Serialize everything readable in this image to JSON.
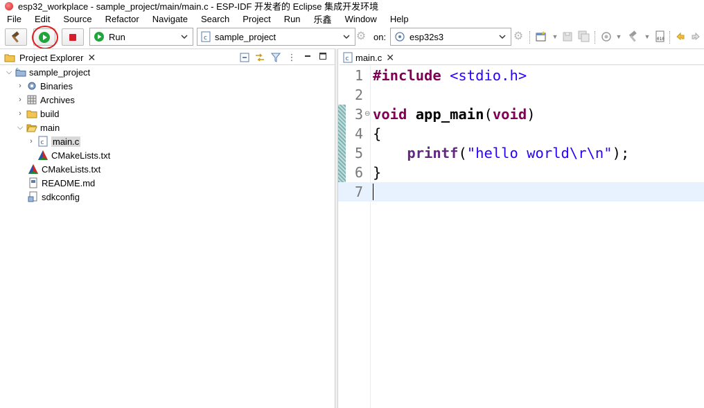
{
  "window": {
    "title": "esp32_workplace - sample_project/main/main.c - ESP-IDF 开发者的 Eclipse 集成开发环境"
  },
  "menu": [
    "File",
    "Edit",
    "Source",
    "Refactor",
    "Navigate",
    "Search",
    "Project",
    "Run",
    "乐鑫",
    "Window",
    "Help"
  ],
  "toolbar": {
    "launch_mode": "Run",
    "launch_config": "sample_project",
    "on_label": "on:",
    "launch_target": "esp32s3"
  },
  "project_explorer": {
    "tab_label": "Project Explorer",
    "items": [
      {
        "label": "sample_project",
        "icon": "project-icon",
        "level": 0,
        "expanded": true
      },
      {
        "label": "Binaries",
        "icon": "binaries-icon",
        "level": 1,
        "expanded": false
      },
      {
        "label": "Archives",
        "icon": "archives-icon",
        "level": 1,
        "expanded": false
      },
      {
        "label": "build",
        "icon": "folder-icon",
        "level": 1,
        "expanded": false
      },
      {
        "label": "main",
        "icon": "folder-open-icon",
        "level": 1,
        "expanded": true
      },
      {
        "label": "main.c",
        "icon": "c-file-icon",
        "level": 2,
        "expanded": false,
        "selected": true
      },
      {
        "label": "CMakeLists.txt",
        "icon": "cmake-icon",
        "level": 2
      },
      {
        "label": "CMakeLists.txt",
        "icon": "cmake-icon",
        "level": 1
      },
      {
        "label": "README.md",
        "icon": "markdown-file-icon",
        "level": 1
      },
      {
        "label": "sdkconfig",
        "icon": "config-file-icon",
        "level": 1
      }
    ]
  },
  "editor": {
    "tab_label": "main.c",
    "line_numbers": [
      "1",
      "2",
      "3",
      "4",
      "5",
      "6",
      "7"
    ],
    "lines": {
      "l1_directive": "#include",
      "l1_header": "<stdio.h>",
      "l3_type": "void",
      "l3_name": "app_main",
      "l3_open": "(",
      "l3_param": "void",
      "l3_close": ")",
      "l4": "{",
      "l5_indent": "    ",
      "l5_call": "printf",
      "l5_open": "(",
      "l5_string": "\"hello world\\r\\n\"",
      "l5_close": ");",
      "l6": "}"
    }
  },
  "colors": {
    "keyword": "#7f0055",
    "string": "#2a00ff",
    "current_line": "#e8f2fe",
    "annotation": "#e01c1c"
  }
}
